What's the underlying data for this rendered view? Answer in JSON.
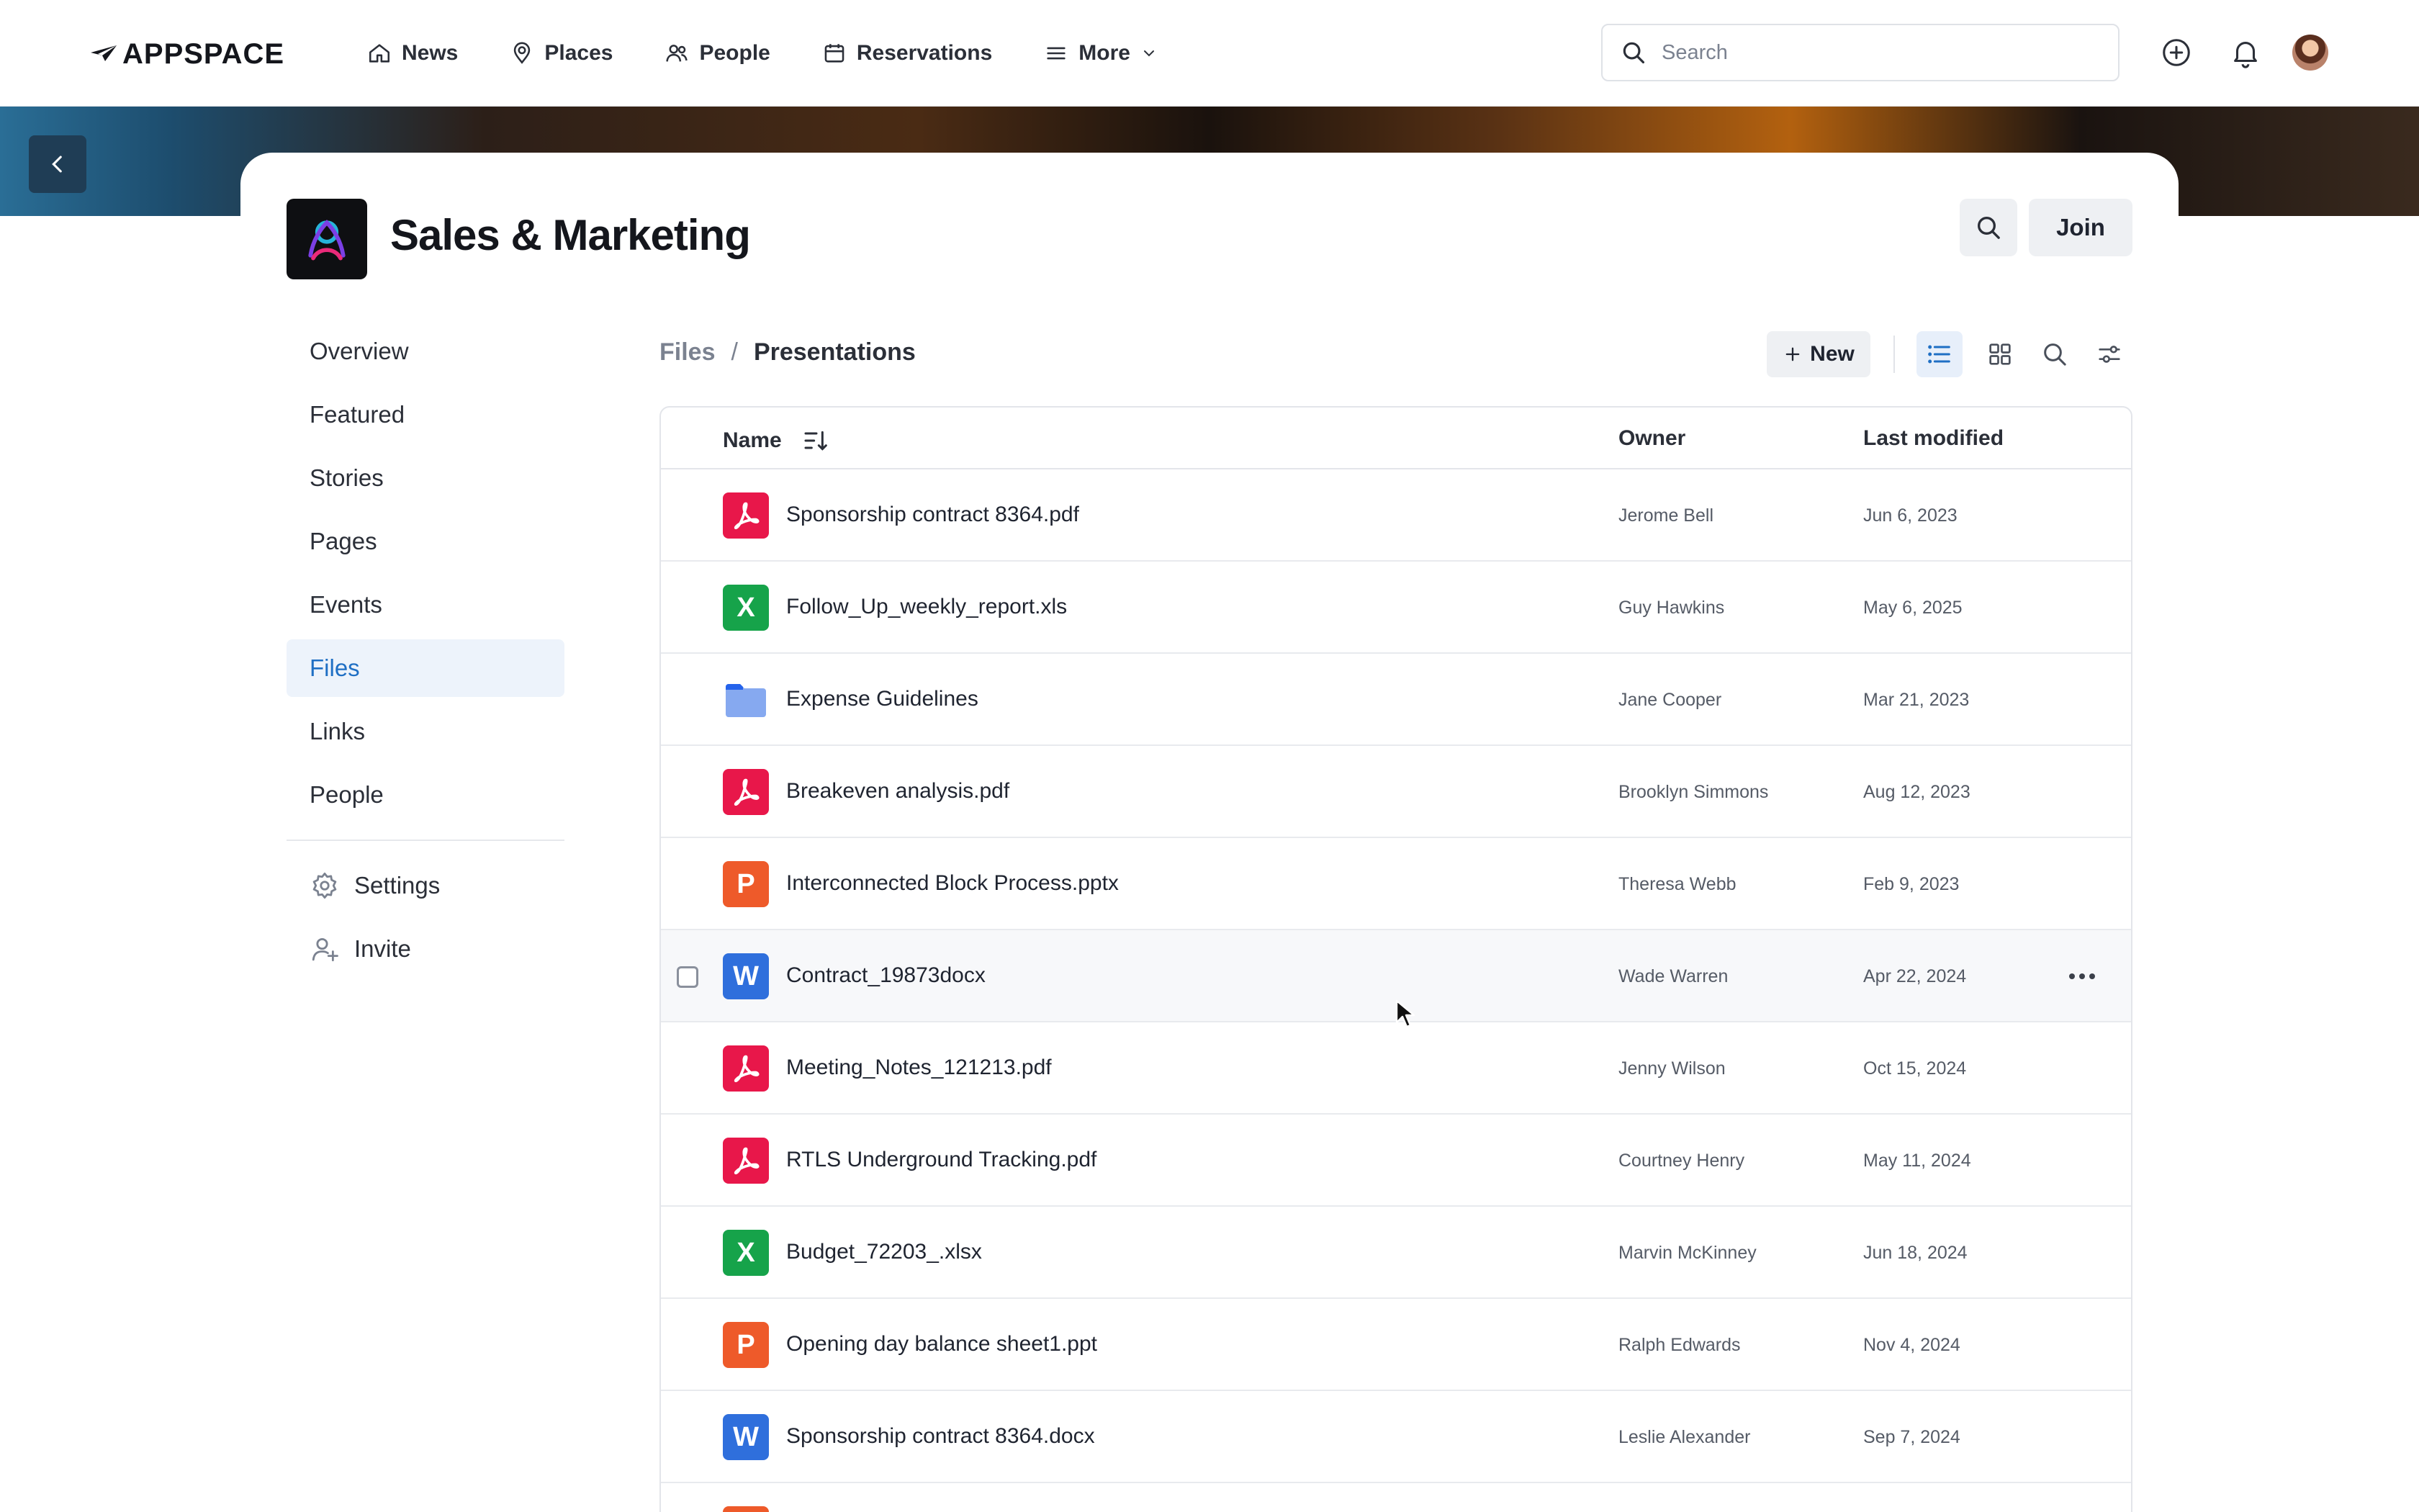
{
  "brand": {
    "name": "APPSPACE"
  },
  "nav": [
    {
      "label": "News",
      "icon": "home-icon"
    },
    {
      "label": "Places",
      "icon": "location-icon"
    },
    {
      "label": "People",
      "icon": "people-icon"
    },
    {
      "label": "Reservations",
      "icon": "calendar-icon"
    },
    {
      "label": "More",
      "icon": "menu-icon"
    }
  ],
  "search": {
    "placeholder": "Search"
  },
  "space": {
    "title": "Sales & Marketing",
    "join_label": "Join"
  },
  "side_menu": {
    "items": [
      "Overview",
      "Featured",
      "Stories",
      "Pages",
      "Events",
      "Files",
      "Links",
      "People"
    ],
    "active": "Files",
    "settings_label": "Settings",
    "invite_label": "Invite"
  },
  "breadcrumb": {
    "root": "Files",
    "separator": "/",
    "current": "Presentations"
  },
  "toolbar": {
    "new_label": "New"
  },
  "table": {
    "headers": {
      "name": "Name",
      "owner": "Owner",
      "modified": "Last modified"
    },
    "rows": [
      {
        "type": "pdf",
        "name": "Sponsorship contract 8364.pdf",
        "owner": "Jerome Bell",
        "modified": "Jun 6, 2023"
      },
      {
        "type": "xls",
        "letter": "X",
        "name": "Follow_Up_weekly_report.xls",
        "owner": "Guy Hawkins",
        "modified": "May 6, 2025"
      },
      {
        "type": "folder",
        "name": "Expense Guidelines",
        "owner": "Jane Cooper",
        "modified": "Mar 21, 2023"
      },
      {
        "type": "pdf",
        "name": "Breakeven analysis.pdf",
        "owner": "Brooklyn Simmons",
        "modified": "Aug 12, 2023"
      },
      {
        "type": "ppt",
        "letter": "P",
        "name": "Interconnected Block Process.pptx",
        "owner": "Theresa Webb",
        "modified": "Feb 9, 2023"
      },
      {
        "type": "doc",
        "letter": "W",
        "name": "Contract_19873docx",
        "owner": "Wade Warren",
        "modified": "Apr 22, 2024",
        "hovered": true
      },
      {
        "type": "pdf",
        "name": "Meeting_Notes_121213.pdf",
        "owner": "Jenny Wilson",
        "modified": "Oct 15, 2024"
      },
      {
        "type": "pdf",
        "name": "RTLS Underground Tracking.pdf",
        "owner": "Courtney Henry",
        "modified": "May 11, 2024"
      },
      {
        "type": "xls",
        "letter": "X",
        "name": "Budget_72203_.xlsx",
        "owner": "Marvin McKinney",
        "modified": "Jun 18, 2024"
      },
      {
        "type": "ppt",
        "letter": "P",
        "name": "Opening day balance sheet1.ppt",
        "owner": "Ralph Edwards",
        "modified": "Nov 4, 2024"
      },
      {
        "type": "doc",
        "letter": "W",
        "name": "Sponsorship contract 8364.docx",
        "owner": "Leslie Alexander",
        "modified": "Sep 7, 2024"
      },
      {
        "type": "ppt",
        "letter": "",
        "name": "",
        "owner": "",
        "modified": ""
      }
    ]
  },
  "colors": {
    "accent": "#1f6fc4",
    "pdf": "#e8174a",
    "xls": "#16a34a",
    "ppt": "#ee5a2a",
    "doc": "#2f6fdc",
    "folder": "#86a9f0"
  }
}
